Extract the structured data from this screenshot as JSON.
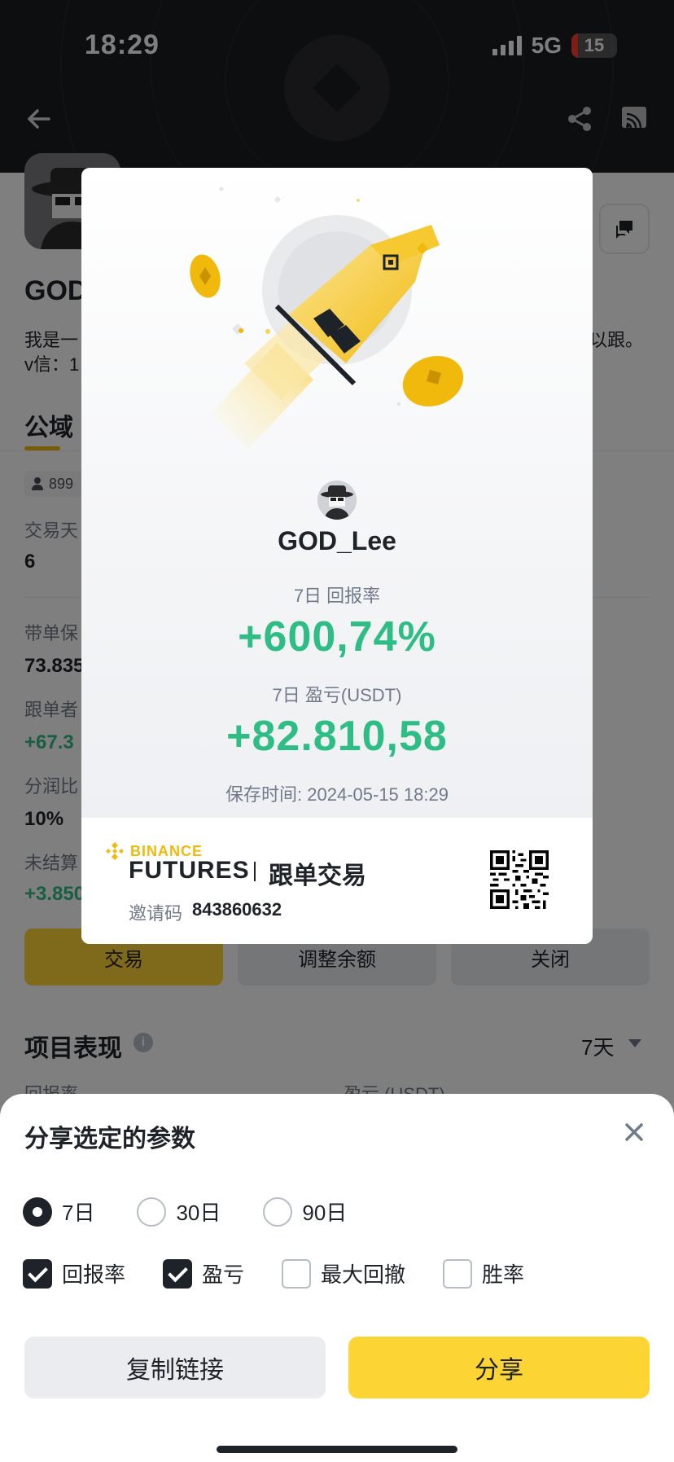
{
  "status_bar": {
    "time": "18:29",
    "network": "5G",
    "battery": "15",
    "battery_level_percent": 15
  },
  "profile": {
    "name": "GOD",
    "bio_line1": "我是一",
    "bio_line1_end": "以跟。",
    "bio_line2": "v信：1",
    "tab_active": "公域",
    "followers_chip": "899",
    "stats": [
      {
        "label": "交易天",
        "value": "6",
        "green": false
      },
      {
        "label": "带单保",
        "value": "73.835",
        "green": false
      },
      {
        "label": "跟单者",
        "value": "+67.3",
        "green": true
      },
      {
        "label": "分润比",
        "value": "10%",
        "green": false
      },
      {
        "label": "未结算",
        "value": "+3.850",
        "green": true
      }
    ],
    "buttons": {
      "trade": "交易",
      "adjust": "调整余额",
      "close": "关闭"
    },
    "section_title": "项目表现",
    "period": "7天",
    "col_roi": "回报率",
    "col_pnl": "盈亏 (USDT)"
  },
  "card": {
    "username": "GOD_Lee",
    "roi_label": "7日 回报率",
    "roi_value": "+600,74%",
    "pnl_label": "7日 盈亏(USDT)",
    "pnl_value": "+82.810,58",
    "saved_time": "保存时间: 2024-05-15 18:29",
    "brand_binance": "BINANCE",
    "brand_futures": "FUTURES",
    "brand_copy": "跟单交易",
    "referral_label": "邀请码",
    "referral_code": "843860632"
  },
  "sheet": {
    "title": "分享选定的参数",
    "periods": [
      {
        "label": "7日",
        "selected": true
      },
      {
        "label": "30日",
        "selected": false
      },
      {
        "label": "90日",
        "selected": false
      }
    ],
    "params": [
      {
        "label": "回报率",
        "checked": true
      },
      {
        "label": "盈亏",
        "checked": true
      },
      {
        "label": "最大回撤",
        "checked": false
      },
      {
        "label": "胜率",
        "checked": false
      }
    ],
    "copy_link": "复制链接",
    "share": "分享"
  },
  "colors": {
    "accent": "#fcd535",
    "green": "#2ebd85",
    "brand": "#f0b90b"
  },
  "icons": [
    "back-arrow-icon",
    "share-icon",
    "cast-icon",
    "chat-icon",
    "info-icon",
    "caret-down-icon",
    "close-icon",
    "qr-code-icon",
    "binance-logo-icon"
  ]
}
